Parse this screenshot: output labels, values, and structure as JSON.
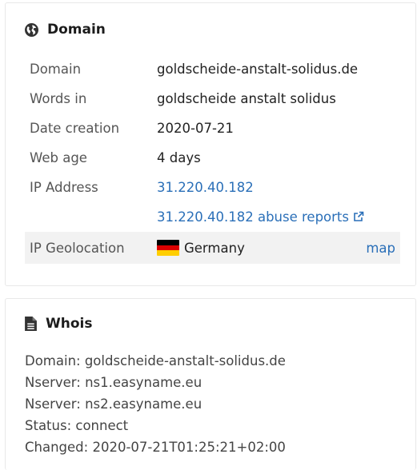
{
  "domain_card": {
    "title": "Domain",
    "title_icon": "globe-icon",
    "rows": [
      {
        "label": "Domain",
        "value": "goldscheide-anstalt-solidus.de"
      },
      {
        "label": "Words in",
        "value": "goldscheide anstalt solidus"
      },
      {
        "label": "Date creation",
        "value": "2020-07-21"
      },
      {
        "label": "Web age",
        "value": "4 days"
      },
      {
        "label": "IP Address",
        "value": "31.220.40.182"
      }
    ],
    "abuse_link": "31.220.40.182 abuse reports",
    "abuse_icon": "external-link-icon",
    "geo": {
      "label": "IP Geolocation",
      "country": "Germany",
      "flag_icon": "germany-flag-icon",
      "map_link": "map"
    }
  },
  "whois_card": {
    "title": "Whois",
    "title_icon": "document-icon",
    "lines": [
      "Domain: goldscheide-anstalt-solidus.de",
      "Nserver: ns1.easyname.eu",
      "Nserver: ns2.easyname.eu",
      "Status: connect",
      "Changed: 2020-07-21T01:25:21+02:00"
    ]
  },
  "colors": {
    "link": "#2a6fb8",
    "geo_row_bg": "#f2f2f2",
    "border": "#e8e8e8"
  }
}
